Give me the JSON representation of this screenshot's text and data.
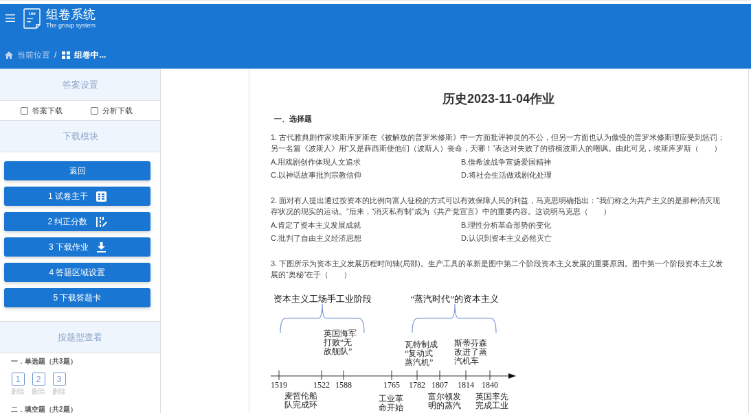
{
  "header": {
    "logo_text": "100",
    "title": "组卷系统",
    "subtitle": "The group system"
  },
  "breadcrumb": {
    "separator": "/",
    "items": [
      {
        "label": "当前位置",
        "kind": "home",
        "current": false
      },
      {
        "label": "组卷中...",
        "kind": "grid",
        "current": true
      }
    ]
  },
  "answer_settings": {
    "title": "答案设置",
    "options": [
      {
        "label": "答案下载",
        "checked": false
      },
      {
        "label": "分析下载",
        "checked": false
      }
    ]
  },
  "download_module": {
    "title": "下载模块",
    "buttons": [
      {
        "label": "返回",
        "kind": "plain"
      },
      {
        "label": "1 试卷主干",
        "kind": "table"
      },
      {
        "label": "2 纠正分数",
        "kind": "edit"
      },
      {
        "label": "3 下载作业",
        "kind": "download"
      },
      {
        "label": "4 答题区域设置",
        "kind": "plain"
      },
      {
        "label": "5 下载答题卡",
        "kind": "plain"
      }
    ]
  },
  "by_type": {
    "title": "按题型查看",
    "groups": [
      {
        "heading": "一．单选题（共3题）",
        "questions": [
          {
            "number": "1",
            "action": "删除"
          },
          {
            "number": "2",
            "action": "删除"
          },
          {
            "number": "3",
            "action": "删除"
          }
        ]
      },
      {
        "heading": "二．填空题（共2题）"
      }
    ]
  },
  "document": {
    "title": "历史2023-11-04作业",
    "sections": [
      {
        "heading": "一、选择题",
        "questions": [
          {
            "stem": "1. 古代雅典剧作家埃斯库罗斯在《被解放的普罗米修斯》中一方面批评神灵的不公，但另一方面也认为傲慢的普罗米修斯理应受到惩罚；另一名篇《波斯人》用“又是薛西斯使他们（波斯人）丧命，天哪！”表达对失败了的骄横波斯人的嘲讽。由此可见，埃斯库罗斯（　　）",
            "options": [
              "A.用戏剧创作体现人文追求",
              "B.借希波战争宣扬爱国精神",
              "C.以神话故事批判宗教信仰",
              "D.将社会生活做戏剧化处理"
            ]
          },
          {
            "stem": "2. 面对有人提出通过按资本的比例向富人征税的方式可以有效保障人民的利益，马克思明确指出：“我们称之为共产主义的是那种消灭现存状况的现实的运动。”后来，“消灭私有制”成为《共产党宣言》中的重要内容。这说明马克思（　　）",
            "options": [
              "A.肯定了资本主义发展成就",
              "B.理性分析革命形势的变化",
              "C.批判了自由主义经济思想",
              "D.认识到资本主义必然灭亡"
            ]
          },
          {
            "stem": "3. 下图所示为资本主义发展历程时间轴(局部)。生产工具的革新是图中第二个阶段资本主义发展的重要原因。图中第一个阶段资本主义发展的“奥秘”在于（　　）",
            "figure": {
              "stages": [
                {
                  "title": "资本主义工场手工业阶段"
                },
                {
                  "title": "“蒸汽时代”的资本主义"
                }
              ],
              "events": [
                {
                  "year": "1519",
                  "kind": "below",
                  "label": [
                    "麦哲伦船",
                    "队完成环"
                  ]
                },
                {
                  "year": "1522",
                  "kind": "bare"
                },
                {
                  "year": "1588",
                  "kind": "above",
                  "label": [
                    "英国海军",
                    "打败“无",
                    "敌舰队”"
                  ]
                },
                {
                  "year": "1765",
                  "kind": "below",
                  "label": [
                    "工业革",
                    "命开始"
                  ]
                },
                {
                  "year": "1782",
                  "kind": "above",
                  "label": [
                    "瓦特制成",
                    "“复动式",
                    "蒸汽机”"
                  ]
                },
                {
                  "year": "1807",
                  "kind": "below",
                  "label": [
                    "富尔顿发",
                    "明的蒸汽"
                  ]
                },
                {
                  "year": "1814",
                  "kind": "above",
                  "label": [
                    "斯蒂芬森",
                    "改进了蒸",
                    "汽机车"
                  ]
                },
                {
                  "year": "1840",
                  "kind": "below",
                  "label": [
                    "英国率先",
                    "完成工业"
                  ]
                }
              ]
            }
          }
        ]
      }
    ]
  }
}
